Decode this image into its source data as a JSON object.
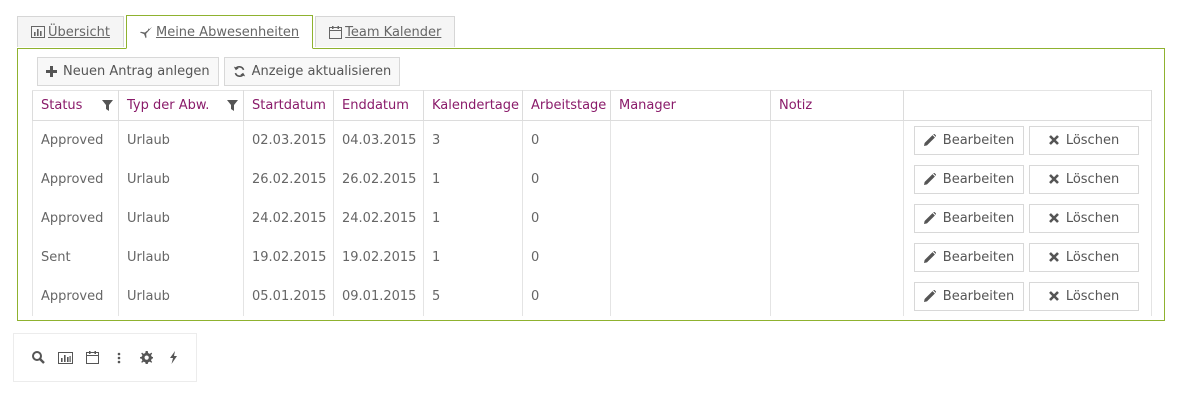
{
  "tabs": [
    {
      "label": "Übersicht",
      "icon": "bar-chart-icon",
      "active": false
    },
    {
      "label": "Meine Abwesenheiten",
      "icon": "plane-icon",
      "active": true
    },
    {
      "label": "Team Kalender",
      "icon": "calendar-icon",
      "active": false
    }
  ],
  "toolbar": {
    "new_label": "Neuen Antrag anlegen",
    "refresh_label": "Anzeige aktualisieren"
  },
  "table": {
    "headers": [
      "Status",
      "Typ der Abw.",
      "Startdatum",
      "Enddatum",
      "Kalendertage",
      "Arbeitstage",
      "Manager",
      "Notiz"
    ],
    "filterable": [
      "Status",
      "Typ der Abw."
    ],
    "rows": [
      {
        "status": "Approved",
        "type": "Urlaub",
        "start": "02.03.2015",
        "end": "04.03.2015",
        "calendar_days": "3",
        "work_days": "0",
        "manager": "",
        "note": ""
      },
      {
        "status": "Approved",
        "type": "Urlaub",
        "start": "26.02.2015",
        "end": "26.02.2015",
        "calendar_days": "1",
        "work_days": "0",
        "manager": "",
        "note": ""
      },
      {
        "status": "Approved",
        "type": "Urlaub",
        "start": "24.02.2015",
        "end": "24.02.2015",
        "calendar_days": "1",
        "work_days": "0",
        "manager": "",
        "note": ""
      },
      {
        "status": "Sent",
        "type": "Urlaub",
        "start": "19.02.2015",
        "end": "19.02.2015",
        "calendar_days": "1",
        "work_days": "0",
        "manager": "",
        "note": ""
      },
      {
        "status": "Approved",
        "type": "Urlaub",
        "start": "05.01.2015",
        "end": "09.01.2015",
        "calendar_days": "5",
        "work_days": "0",
        "manager": "",
        "note": ""
      }
    ],
    "edit_label": "Bearbeiten",
    "delete_label": "Löschen"
  },
  "dock": {
    "icons": [
      "search-icon",
      "bar-chart-icon",
      "calendar-icon",
      "more-vertical-icon",
      "gear-icon",
      "bolt-icon"
    ]
  },
  "colors": {
    "accent_border": "#8fb22f",
    "header_text": "#8a1b6a"
  }
}
